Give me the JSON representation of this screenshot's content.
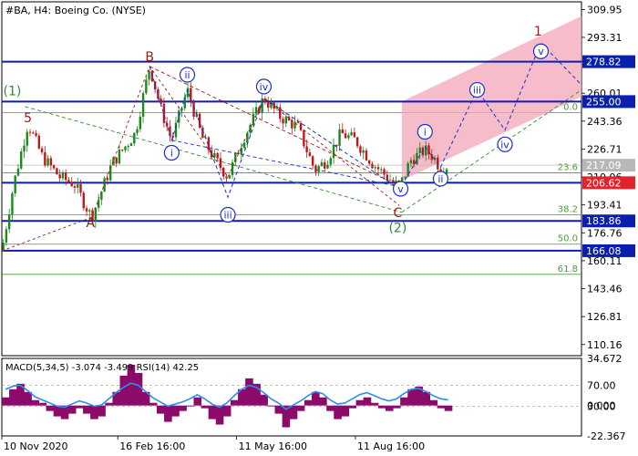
{
  "header": {
    "symbol_text": "#BA, H4:  Boeing Co. (NYSE)"
  },
  "macd_header": {
    "text": "MACD(5,34,5) -3.074 -3.499 RSI(14) 42.25"
  },
  "colors": {
    "bull": "#1a8a1a",
    "bear": "#c01818",
    "hline": "#0a1fb0",
    "fib": "#4a9e2e",
    "channel": "#f4a6b8",
    "wave_blue": "#1a2fc8",
    "wave_red": "#a01818",
    "wave_green": "#2e8b2e",
    "macd_hist": "#8b0a6a",
    "rsi": "#2f8cf0"
  },
  "chart_data": [
    {
      "type": "candlestick",
      "title": "#BA, H4: Boeing Co. (NYSE)",
      "x_ticks": [
        "10 Nov 2020",
        "16 Feb 16:00",
        "11 May 16:00",
        "11 Aug 16:00"
      ],
      "y_ticks": [
        "309.95",
        "293.31",
        "278.82",
        "260.01",
        "243.36",
        "226.71",
        "210.06",
        "193.41",
        "176.76",
        "160.11",
        "143.46",
        "126.81",
        "110.16"
      ],
      "ylim": [
        103.5,
        314.5
      ],
      "current_price": {
        "value": 217.09,
        "label": "217.09"
      },
      "levels": [
        {
          "value": 278.82,
          "label": "278.82",
          "kind": "resistance"
        },
        {
          "value": 255.0,
          "label": "255.00",
          "kind": "resistance"
        },
        {
          "value": 206.62,
          "label": "206.62",
          "kind": "support"
        },
        {
          "value": 183.86,
          "label": "183.86",
          "kind": "support"
        },
        {
          "value": 166.08,
          "label": "166.08",
          "kind": "support"
        }
      ],
      "fib_levels": [
        {
          "value": 248.5,
          "label": "0.0"
        },
        {
          "value": 212.5,
          "label": "23.6"
        },
        {
          "value": 187.5,
          "label": "38.2"
        },
        {
          "value": 170.0,
          "label": "50.0"
        },
        {
          "value": 152.0,
          "label": "61.8"
        }
      ],
      "wave_labels": [
        {
          "text": "(1)",
          "style": "green",
          "value": 261.5,
          "pos": 0.018
        },
        {
          "text": "5",
          "style": "red",
          "value": 245.5,
          "pos": 0.045
        },
        {
          "text": "A",
          "style": "red",
          "value": 183.0,
          "pos": 0.153
        },
        {
          "text": "B",
          "style": "red",
          "value": 282.0,
          "pos": 0.255
        },
        {
          "text": "C",
          "style": "red",
          "value": 189.0,
          "pos": 0.683
        },
        {
          "text": "(2)",
          "style": "green",
          "value": 180.0,
          "pos": 0.683
        },
        {
          "text": "1",
          "style": "red",
          "value": 297.0,
          "pos": 0.925
        },
        {
          "text": "i",
          "style": "blue",
          "value": 224.5,
          "pos": 0.293
        },
        {
          "text": "ii",
          "style": "blue",
          "value": 271.0,
          "pos": 0.32
        },
        {
          "text": "iii",
          "style": "blue",
          "value": 187.5,
          "pos": 0.39
        },
        {
          "text": "iv",
          "style": "blue",
          "value": 264.0,
          "pos": 0.452
        },
        {
          "text": "v",
          "style": "blue",
          "value": 203.0,
          "pos": 0.688
        },
        {
          "text": "i",
          "style": "blue",
          "value": 237.0,
          "pos": 0.73
        },
        {
          "text": "ii",
          "style": "blue",
          "value": 209.0,
          "pos": 0.757
        },
        {
          "text": "iii",
          "style": "blue",
          "value": 262.0,
          "pos": 0.82
        },
        {
          "text": "iv",
          "style": "blue",
          "value": 229.5,
          "pos": 0.868
        },
        {
          "text": "v",
          "style": "blue",
          "value": 285.0,
          "pos": 0.93
        }
      ],
      "projection_red": [
        [
          0.0,
          166.0
        ],
        [
          0.155,
          186.0
        ],
        [
          0.255,
          276.0
        ],
        [
          0.39,
          210.0
        ],
        [
          0.452,
          257.0
        ],
        [
          0.686,
          193.0
        ]
      ],
      "wave_path_blue": [
        [
          0.255,
          276.0
        ],
        [
          0.293,
          232.0
        ],
        [
          0.32,
          262.0
        ],
        [
          0.39,
          198.0
        ],
        [
          0.452,
          257.0
        ],
        [
          0.686,
          203.0
        ],
        [
          0.73,
          228.0
        ],
        [
          0.757,
          216.0
        ],
        [
          0.82,
          262.0
        ],
        [
          0.868,
          238.0
        ],
        [
          0.93,
          290.0
        ],
        [
          1.0,
          265.0
        ]
      ],
      "channel": {
        "top": [
          [
            0.69,
            255.0
          ],
          [
            1.0,
            306.0
          ]
        ],
        "bottom": [
          [
            0.69,
            208.0
          ],
          [
            1.0,
            258.0
          ]
        ]
      },
      "trend_lines": [
        {
          "style": "red-dashed",
          "from": [
            0.255,
            276.0
          ],
          "to": [
            0.69,
            204.0
          ]
        },
        {
          "style": "green-dashed",
          "from": [
            0.04,
            252.0
          ],
          "to": [
            0.69,
            189.0
          ]
        },
        {
          "style": "green-dashed",
          "from": [
            0.69,
            189.0
          ],
          "to": [
            1.0,
            262.0
          ]
        },
        {
          "style": "blue-dashed",
          "from": [
            0.293,
            232.0
          ],
          "to": [
            0.69,
            204.0
          ]
        }
      ],
      "price_path": [
        [
          0.0,
          166.0
        ],
        [
          0.02,
          205.0
        ],
        [
          0.045,
          242.0
        ],
        [
          0.07,
          222.0
        ],
        [
          0.1,
          210.0
        ],
        [
          0.125,
          206.0
        ],
        [
          0.155,
          186.0
        ],
        [
          0.19,
          218.0
        ],
        [
          0.23,
          236.0
        ],
        [
          0.255,
          276.0
        ],
        [
          0.275,
          250.0
        ],
        [
          0.293,
          232.0
        ],
        [
          0.32,
          262.0
        ],
        [
          0.345,
          234.0
        ],
        [
          0.365,
          222.0
        ],
        [
          0.39,
          210.0
        ],
        [
          0.415,
          232.0
        ],
        [
          0.452,
          257.0
        ],
        [
          0.48,
          246.0
        ],
        [
          0.51,
          240.0
        ],
        [
          0.54,
          214.0
        ],
        [
          0.56,
          220.0
        ],
        [
          0.585,
          236.0
        ],
        [
          0.61,
          232.0
        ],
        [
          0.64,
          218.0
        ],
        [
          0.665,
          210.0
        ],
        [
          0.686,
          204.0
        ],
        [
          0.705,
          220.0
        ],
        [
          0.73,
          226.0
        ],
        [
          0.745,
          222.0
        ],
        [
          0.757,
          215.0
        ],
        [
          0.77,
          217.0
        ]
      ]
    },
    {
      "type": "line",
      "title": "MACD(5,34,5) -3.074 -3.499 RSI(14) 42.25",
      "y_ticks": [
        "34.672",
        "70.00",
        "0.000",
        "30.00",
        "-22.367"
      ],
      "ylim": [
        -22.367,
        34.672
      ],
      "series": [
        {
          "name": "MACD",
          "values": [
            6,
            12,
            16,
            10,
            4,
            2,
            -4,
            -8,
            -10,
            -6,
            -2,
            -6,
            -10,
            -8,
            2,
            10,
            22,
            30,
            24,
            10,
            2,
            -6,
            -12,
            -8,
            -4,
            0,
            6,
            -2,
            -10,
            -14,
            -8,
            4,
            12,
            20,
            16,
            8,
            0,
            -6,
            -16,
            -10,
            -4,
            4,
            10,
            6,
            -4,
            -10,
            -8,
            -2,
            4,
            6,
            2,
            -2,
            -4,
            -2,
            6,
            12,
            14,
            10,
            4,
            -2,
            -4
          ]
        },
        {
          "name": "RSI(14)",
          "values": [
            62,
            68,
            70,
            60,
            48,
            42,
            36,
            30,
            28,
            34,
            40,
            36,
            30,
            32,
            44,
            56,
            66,
            74,
            70,
            58,
            46,
            38,
            30,
            34,
            38,
            44,
            52,
            44,
            34,
            28,
            36,
            50,
            62,
            70,
            66,
            56,
            44,
            36,
            24,
            32,
            40,
            50,
            58,
            54,
            42,
            34,
            36,
            44,
            52,
            56,
            50,
            44,
            40,
            44,
            54,
            62,
            64,
            58,
            50,
            44,
            42
          ]
        }
      ],
      "levels": [
        {
          "value": 70,
          "label": "70.00"
        },
        {
          "value": 30,
          "label": "30.00"
        }
      ]
    }
  ]
}
